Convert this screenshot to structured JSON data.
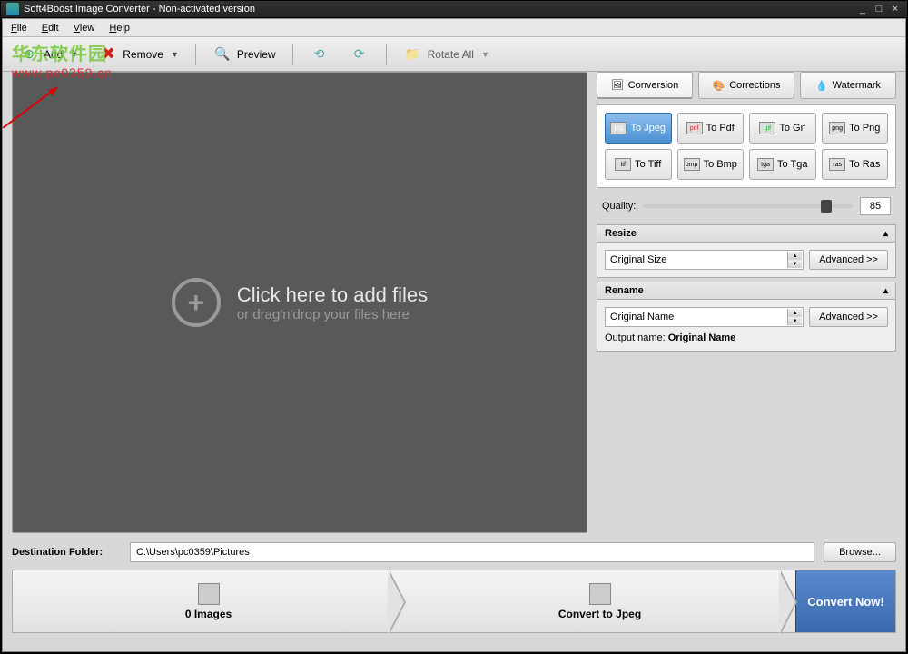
{
  "title": "Soft4Boost Image Converter - Non-activated version",
  "watermark_main": "华东软件园",
  "watermark_sub": "www.pc0359.cn",
  "menu": {
    "file": "File",
    "edit": "Edit",
    "view": "View",
    "help": "Help"
  },
  "toolbar": {
    "add": "Add",
    "remove": "Remove",
    "preview": "Preview",
    "rotate_all": "Rotate All"
  },
  "dropzone": {
    "line1": "Click here to add files",
    "line2": "or drag'n'drop your files here"
  },
  "tabs": {
    "conversion": "Conversion",
    "corrections": "Corrections",
    "watermark": "Watermark"
  },
  "formats": {
    "jpeg": "To Jpeg",
    "pdf": "To Pdf",
    "gif": "To Gif",
    "png": "To Png",
    "tiff": "To Tiff",
    "bmp": "To Bmp",
    "tga": "To Tga",
    "ras": "To Ras"
  },
  "quality": {
    "label": "Quality:",
    "value": "85"
  },
  "resize": {
    "header": "Resize",
    "value": "Original Size",
    "advanced": "Advanced >>"
  },
  "rename": {
    "header": "Rename",
    "value": "Original Name",
    "advanced": "Advanced >>",
    "output_label": "Output name:",
    "output_value": "Original Name"
  },
  "dest": {
    "label": "Destination Folder:",
    "path": "C:\\Users\\pc0359\\Pictures",
    "browse": "Browse..."
  },
  "steps": {
    "images": "0 Images",
    "convert_to": "Convert to Jpeg",
    "convert_now": "Convert Now!"
  }
}
